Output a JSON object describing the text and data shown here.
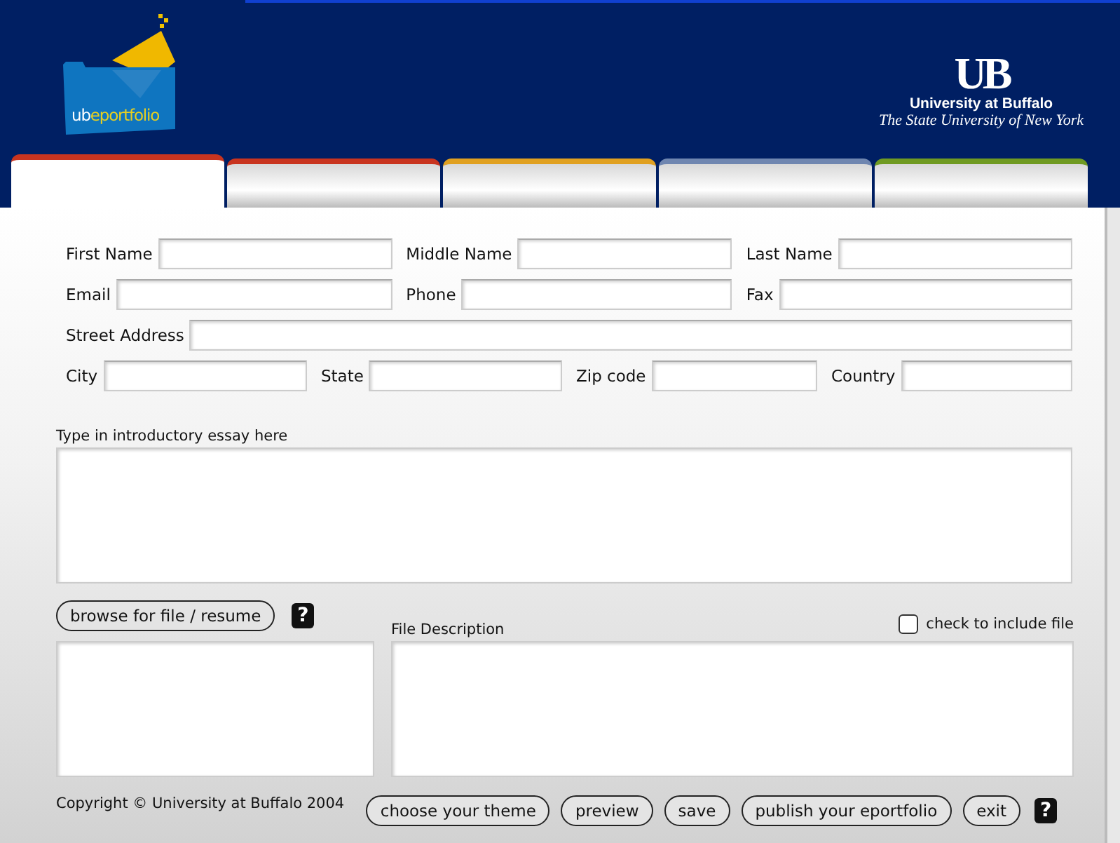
{
  "logo": {
    "prefix": "ub",
    "suffix": "eportfolio"
  },
  "university": {
    "mark": "UB",
    "name": "University at Buffalo",
    "subtitle": "The State University of New York"
  },
  "tabs": [
    {
      "color": "#c8341f",
      "selected": true
    },
    {
      "color": "#c8341f",
      "selected": false
    },
    {
      "color": "#e0a020",
      "selected": false
    },
    {
      "color": "#6f86b0",
      "selected": false
    },
    {
      "color": "#6f9a22",
      "selected": false
    }
  ],
  "form_rows": [
    [
      {
        "label": "First Name"
      },
      {
        "label": "Middle Name"
      },
      {
        "label": "Last Name"
      }
    ],
    [
      {
        "label": "Email"
      },
      {
        "label": "Phone"
      },
      {
        "label": "Fax"
      }
    ],
    [
      {
        "label": "Street Address"
      }
    ],
    [
      {
        "label": "City"
      },
      {
        "label": "State"
      },
      {
        "label": "Zip code"
      },
      {
        "label": "Country"
      }
    ]
  ],
  "essay": {
    "label": "Type in introductory essay here"
  },
  "file_section": {
    "browse_button": "browse for file / resume",
    "help": "?",
    "description_label": "File Description",
    "include_file": {
      "label": "check to include file",
      "checked": false
    }
  },
  "footer": {
    "copyright": "Copyright © University at Buffalo 2004",
    "buttons": [
      "choose your theme",
      "preview",
      "save",
      "publish your eportfolio",
      "exit"
    ],
    "help": "?"
  }
}
